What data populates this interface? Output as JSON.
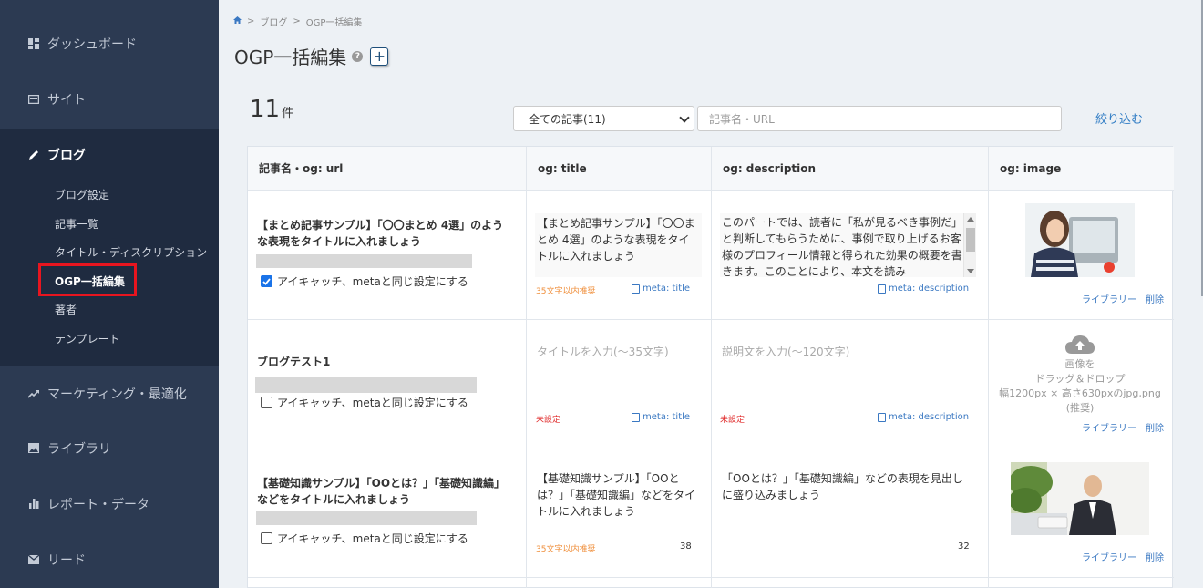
{
  "sidebar": {
    "items": [
      {
        "label": "ダッシュボード",
        "icon": "dashboard-icon"
      },
      {
        "label": "サイト",
        "icon": "site-icon"
      },
      {
        "label": "ブログ",
        "icon": "pencil-icon"
      },
      {
        "label": "マーケティング・最適化",
        "icon": "trend-icon"
      },
      {
        "label": "ライブラリ",
        "icon": "image-icon"
      },
      {
        "label": "レポート・データ",
        "icon": "bar-chart-icon"
      },
      {
        "label": "リード",
        "icon": "mail-icon"
      }
    ],
    "blog_sub": [
      "ブログ設定",
      "記事一覧",
      "タイトル・ディスクリプション",
      "OGP一括編集",
      "著者",
      "テンプレート"
    ]
  },
  "breadcrumb": {
    "sep": ">",
    "blog": "ブログ",
    "current": "OGP一括編集"
  },
  "page": {
    "title": "OGP一括編集",
    "help": "?",
    "add": "+"
  },
  "count": {
    "value": "11",
    "unit": "件"
  },
  "filter": {
    "select_value": "全ての記事(11)",
    "search_placeholder": "記事名・URL",
    "button": "絞り込む"
  },
  "table": {
    "headers": [
      "記事名・og: url",
      "og: title",
      "og: description",
      "og: image"
    ],
    "same_setting_label": "アイキャッチ、metaと同じ設定にする",
    "meta_title_link": "meta: title",
    "meta_desc_link": "meta: description",
    "library_label": "ライブラリー",
    "delete_label": "削除",
    "rows": [
      {
        "name": "【まとめ記事サンプル】「〇〇まとめ 4選」のような表現をタイトルに入れましょう",
        "checked": true,
        "og_title": "【まとめ記事サンプル】「〇〇まとめ 4選」のような表現をタイトルに入れましょう",
        "title_hint": "35文字以内推奨",
        "og_description": "このパートでは、読者に「私が見るべき事例だ」と判断してもらうために、事例で取り上げるお客様のプロフィール情報と得られた効果の概要を書きます。このことにより、本文を読み"
      },
      {
        "name": "ブログテスト1",
        "checked": false,
        "title_placeholder": "タイトルを入力(〜35文字)",
        "title_hint": "未設定",
        "desc_placeholder": "説明文を入力(〜120文字)",
        "desc_hint": "未設定",
        "upload_text": [
          "画像を",
          "ドラッグ＆ドロップ",
          "幅1200px × 高さ630pxのjpg,png",
          "(推奨)"
        ]
      },
      {
        "name": "【基礎知識サンプル】「OOとは？」「基礎知識編」などをタイトルに入れましょう",
        "checked": false,
        "og_title": "【基礎知識サンプル】「OOとは？」「基礎知識編」などをタイトルに入れましょう",
        "title_hint": "35文字以内推奨",
        "title_count": "38",
        "og_description": "「OOとは？」「基礎知識編」などの表現を見出しに盛り込みましょう",
        "desc_count": "32"
      }
    ]
  }
}
